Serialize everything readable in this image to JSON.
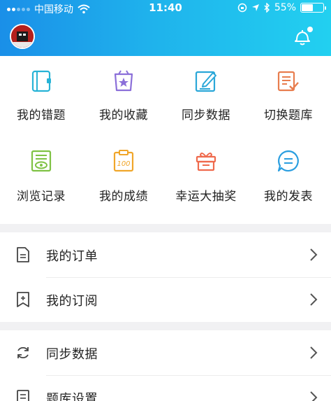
{
  "status_bar": {
    "carrier": "中国移动",
    "time": "11:40",
    "battery": "55%",
    "battery_level": 0.55,
    "icons": [
      "wifi-icon",
      "location-icon",
      "bluetooth-icon",
      "rotation-lock-icon"
    ]
  },
  "header": {
    "avatar": "avatar",
    "bell": "bell-icon",
    "gradient": [
      "#1a8fe8",
      "#22d0f0"
    ]
  },
  "grid": {
    "items": [
      {
        "label": "我的错题",
        "icon": "notebook-icon",
        "color": "#27b3d6"
      },
      {
        "label": "我的收藏",
        "icon": "star-bag-icon",
        "color": "#8b6fd9"
      },
      {
        "label": "同步数据",
        "icon": "edit-icon",
        "color": "#2aa7d8"
      },
      {
        "label": "切换题库",
        "icon": "document-check-icon",
        "color": "#e87d4e"
      },
      {
        "label": "浏览记录",
        "icon": "eye-document-icon",
        "color": "#7fc244"
      },
      {
        "label": "我的成绩",
        "icon": "score-100-icon",
        "color": "#f0a62a"
      },
      {
        "label": "幸运大抽奖",
        "icon": "gift-icon",
        "color": "#ef6a4d"
      },
      {
        "label": "我的发表",
        "icon": "chat-bubble-icon",
        "color": "#2a9ee0"
      }
    ]
  },
  "list": {
    "items": [
      {
        "label": "我的订单",
        "icon": "order-icon"
      },
      {
        "label": "我的订阅",
        "icon": "bookmark-icon"
      },
      {
        "label": "同步数据",
        "icon": "sync-icon"
      },
      {
        "label": "题库设置",
        "icon": "settings-doc-icon"
      }
    ]
  }
}
